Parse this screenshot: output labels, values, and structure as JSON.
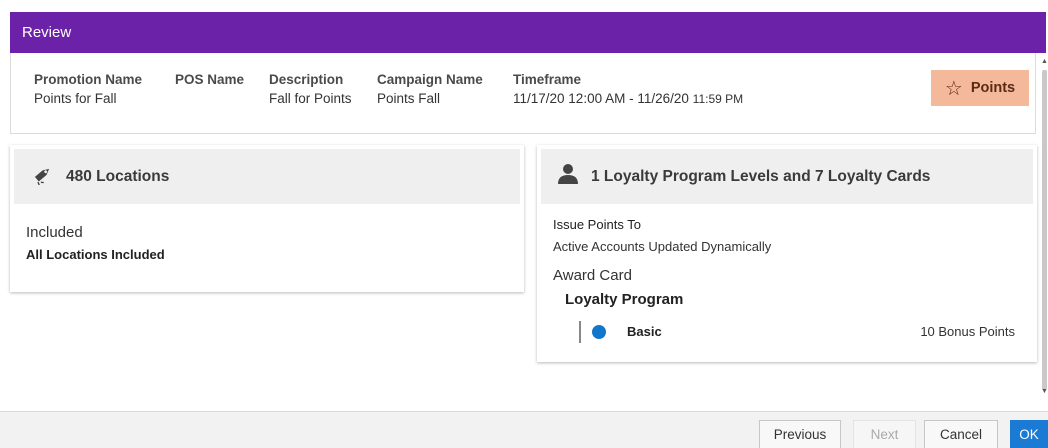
{
  "dialog": {
    "title": "Review"
  },
  "summary": {
    "promotion_name": {
      "label": "Promotion Name",
      "value": "Points for Fall"
    },
    "pos_name": {
      "label": "POS Name",
      "value": ""
    },
    "description": {
      "label": "Description",
      "value": "Fall for Points"
    },
    "campaign_name": {
      "label": "Campaign Name",
      "value": "Points Fall"
    },
    "timeframe": {
      "label": "Timeframe",
      "value_main": "11/17/20 12:00 AM - 11/26/20",
      "value_time": "11:59 PM"
    },
    "type_badge": {
      "label": "Points",
      "icon": "star-icon"
    }
  },
  "locations": {
    "heading": "480 Locations",
    "icon": "tag-icon",
    "status": "Included",
    "detail": "All Locations Included"
  },
  "loyalty": {
    "heading": "1 Loyalty Program Levels and 7 Loyalty Cards",
    "icon": "user-icon",
    "issue_label": "Issue Points To",
    "issue_value": "Active Accounts Updated Dynamically",
    "award_card": "Award Card",
    "program_title": "Loyalty Program",
    "levels": [
      {
        "name": "Basic",
        "points": "10 Bonus Points",
        "dot_color": "#1177cc"
      }
    ]
  },
  "footer": {
    "previous": "Previous",
    "next": "Next",
    "cancel": "Cancel",
    "ok": "OK"
  },
  "colors": {
    "title_bar": "#6b21a8",
    "points_badge": "#f3b99a",
    "primary_button": "#1a7ad4"
  }
}
